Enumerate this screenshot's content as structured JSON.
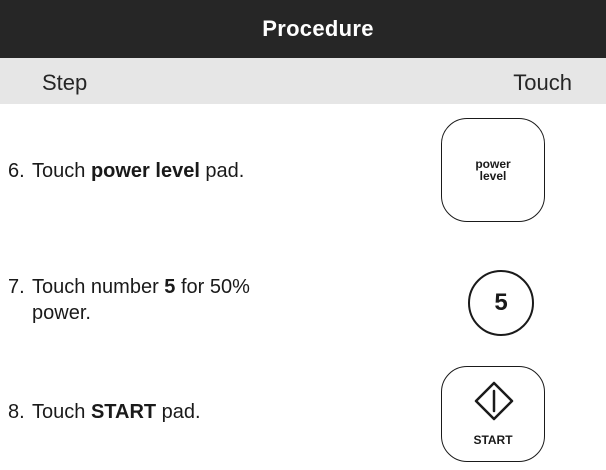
{
  "header": {
    "title": "Procedure"
  },
  "columns": {
    "step": "Step",
    "touch": "Touch"
  },
  "steps": [
    {
      "number": "6.",
      "pre": "Touch ",
      "bold": "power level",
      "post": " pad.",
      "cont": "",
      "pad": {
        "label": "power\nlevel",
        "icon": "power-level-pad"
      }
    },
    {
      "number": "7.",
      "pre": "Touch number ",
      "bold": "5",
      "post": " for 50%",
      "cont": "power.",
      "pad": {
        "label": "5",
        "icon": "number-5-pad"
      }
    },
    {
      "number": "8.",
      "pre": "Touch ",
      "bold": "START",
      "post": " pad.",
      "cont": "",
      "pad": {
        "label": "START",
        "icon": "start-diamond-icon"
      }
    }
  ],
  "colors": {
    "header_bg": "#262626",
    "header_text": "#ffffff",
    "subheader_bg": "#e6e6e6",
    "text": "#1a1a1a"
  }
}
